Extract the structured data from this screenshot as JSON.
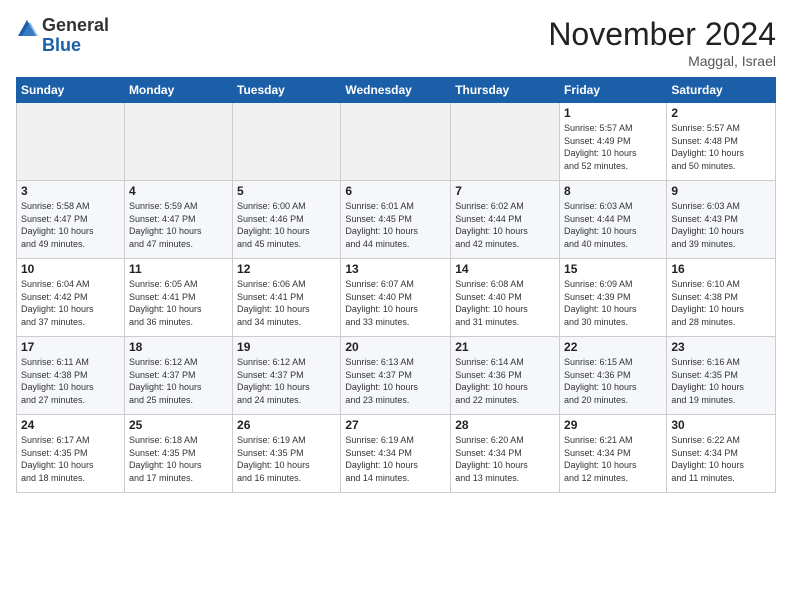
{
  "logo": {
    "general": "General",
    "blue": "Blue"
  },
  "header": {
    "month": "November 2024",
    "location": "Maggal, Israel"
  },
  "weekdays": [
    "Sunday",
    "Monday",
    "Tuesday",
    "Wednesday",
    "Thursday",
    "Friday",
    "Saturday"
  ],
  "weeks": [
    [
      {
        "day": "",
        "info": ""
      },
      {
        "day": "",
        "info": ""
      },
      {
        "day": "",
        "info": ""
      },
      {
        "day": "",
        "info": ""
      },
      {
        "day": "",
        "info": ""
      },
      {
        "day": "1",
        "info": "Sunrise: 5:57 AM\nSunset: 4:49 PM\nDaylight: 10 hours\nand 52 minutes."
      },
      {
        "day": "2",
        "info": "Sunrise: 5:57 AM\nSunset: 4:48 PM\nDaylight: 10 hours\nand 50 minutes."
      }
    ],
    [
      {
        "day": "3",
        "info": "Sunrise: 5:58 AM\nSunset: 4:47 PM\nDaylight: 10 hours\nand 49 minutes."
      },
      {
        "day": "4",
        "info": "Sunrise: 5:59 AM\nSunset: 4:47 PM\nDaylight: 10 hours\nand 47 minutes."
      },
      {
        "day": "5",
        "info": "Sunrise: 6:00 AM\nSunset: 4:46 PM\nDaylight: 10 hours\nand 45 minutes."
      },
      {
        "day": "6",
        "info": "Sunrise: 6:01 AM\nSunset: 4:45 PM\nDaylight: 10 hours\nand 44 minutes."
      },
      {
        "day": "7",
        "info": "Sunrise: 6:02 AM\nSunset: 4:44 PM\nDaylight: 10 hours\nand 42 minutes."
      },
      {
        "day": "8",
        "info": "Sunrise: 6:03 AM\nSunset: 4:44 PM\nDaylight: 10 hours\nand 40 minutes."
      },
      {
        "day": "9",
        "info": "Sunrise: 6:03 AM\nSunset: 4:43 PM\nDaylight: 10 hours\nand 39 minutes."
      }
    ],
    [
      {
        "day": "10",
        "info": "Sunrise: 6:04 AM\nSunset: 4:42 PM\nDaylight: 10 hours\nand 37 minutes."
      },
      {
        "day": "11",
        "info": "Sunrise: 6:05 AM\nSunset: 4:41 PM\nDaylight: 10 hours\nand 36 minutes."
      },
      {
        "day": "12",
        "info": "Sunrise: 6:06 AM\nSunset: 4:41 PM\nDaylight: 10 hours\nand 34 minutes."
      },
      {
        "day": "13",
        "info": "Sunrise: 6:07 AM\nSunset: 4:40 PM\nDaylight: 10 hours\nand 33 minutes."
      },
      {
        "day": "14",
        "info": "Sunrise: 6:08 AM\nSunset: 4:40 PM\nDaylight: 10 hours\nand 31 minutes."
      },
      {
        "day": "15",
        "info": "Sunrise: 6:09 AM\nSunset: 4:39 PM\nDaylight: 10 hours\nand 30 minutes."
      },
      {
        "day": "16",
        "info": "Sunrise: 6:10 AM\nSunset: 4:38 PM\nDaylight: 10 hours\nand 28 minutes."
      }
    ],
    [
      {
        "day": "17",
        "info": "Sunrise: 6:11 AM\nSunset: 4:38 PM\nDaylight: 10 hours\nand 27 minutes."
      },
      {
        "day": "18",
        "info": "Sunrise: 6:12 AM\nSunset: 4:37 PM\nDaylight: 10 hours\nand 25 minutes."
      },
      {
        "day": "19",
        "info": "Sunrise: 6:12 AM\nSunset: 4:37 PM\nDaylight: 10 hours\nand 24 minutes."
      },
      {
        "day": "20",
        "info": "Sunrise: 6:13 AM\nSunset: 4:37 PM\nDaylight: 10 hours\nand 23 minutes."
      },
      {
        "day": "21",
        "info": "Sunrise: 6:14 AM\nSunset: 4:36 PM\nDaylight: 10 hours\nand 22 minutes."
      },
      {
        "day": "22",
        "info": "Sunrise: 6:15 AM\nSunset: 4:36 PM\nDaylight: 10 hours\nand 20 minutes."
      },
      {
        "day": "23",
        "info": "Sunrise: 6:16 AM\nSunset: 4:35 PM\nDaylight: 10 hours\nand 19 minutes."
      }
    ],
    [
      {
        "day": "24",
        "info": "Sunrise: 6:17 AM\nSunset: 4:35 PM\nDaylight: 10 hours\nand 18 minutes."
      },
      {
        "day": "25",
        "info": "Sunrise: 6:18 AM\nSunset: 4:35 PM\nDaylight: 10 hours\nand 17 minutes."
      },
      {
        "day": "26",
        "info": "Sunrise: 6:19 AM\nSunset: 4:35 PM\nDaylight: 10 hours\nand 16 minutes."
      },
      {
        "day": "27",
        "info": "Sunrise: 6:19 AM\nSunset: 4:34 PM\nDaylight: 10 hours\nand 14 minutes."
      },
      {
        "day": "28",
        "info": "Sunrise: 6:20 AM\nSunset: 4:34 PM\nDaylight: 10 hours\nand 13 minutes."
      },
      {
        "day": "29",
        "info": "Sunrise: 6:21 AM\nSunset: 4:34 PM\nDaylight: 10 hours\nand 12 minutes."
      },
      {
        "day": "30",
        "info": "Sunrise: 6:22 AM\nSunset: 4:34 PM\nDaylight: 10 hours\nand 11 minutes."
      }
    ]
  ]
}
